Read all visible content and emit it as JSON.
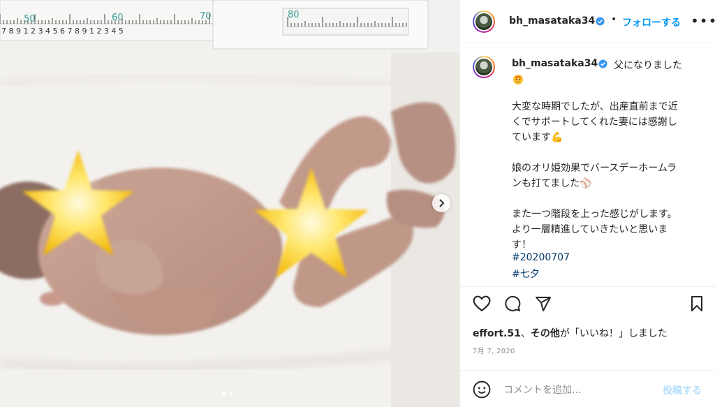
{
  "photo": {
    "ruler_numbers": [
      "50",
      "60",
      "70",
      "80"
    ],
    "ruler_digits_left": "7 8 9",
    "carousel_total": 2,
    "carousel_index": 1
  },
  "header": {
    "username": "bh_masataka34",
    "separator": "•",
    "follow_label": "フォローする"
  },
  "caption": {
    "username": "bh_masataka34",
    "title": "父になりました",
    "lines": [
      "大変な時期でしたが、出産直前まで近",
      "くでサポートしてくれた妻には感謝し",
      "ています💪",
      "",
      "娘のオリ姫効果でバースデーホームラ",
      "ンも打てました⚾",
      "",
      "また一つ階段を上った感じがします。",
      "より一層精進していきたいと思いま",
      "す！"
    ],
    "hashtags": [
      "#20200707",
      "#七夕"
    ]
  },
  "engagement": {
    "liker": "effort.51",
    "likes_suffix_bold": "その他",
    "likes_text": "が「いいね！」しました",
    "sep": "、",
    "date": "7月 7, 2020"
  },
  "comment": {
    "placeholder": "コメントを追加...",
    "post_label": "投稿する"
  },
  "colors": {
    "link": "#0095f6",
    "hashtag": "#00376b",
    "post_disabled": "#b2dffc",
    "muted": "#8e8e8e"
  },
  "icons": [
    "heart-icon",
    "comment-icon",
    "share-icon",
    "bookmark-icon",
    "emoji-icon",
    "verified-icon",
    "more-icon",
    "chevron-right-icon"
  ]
}
